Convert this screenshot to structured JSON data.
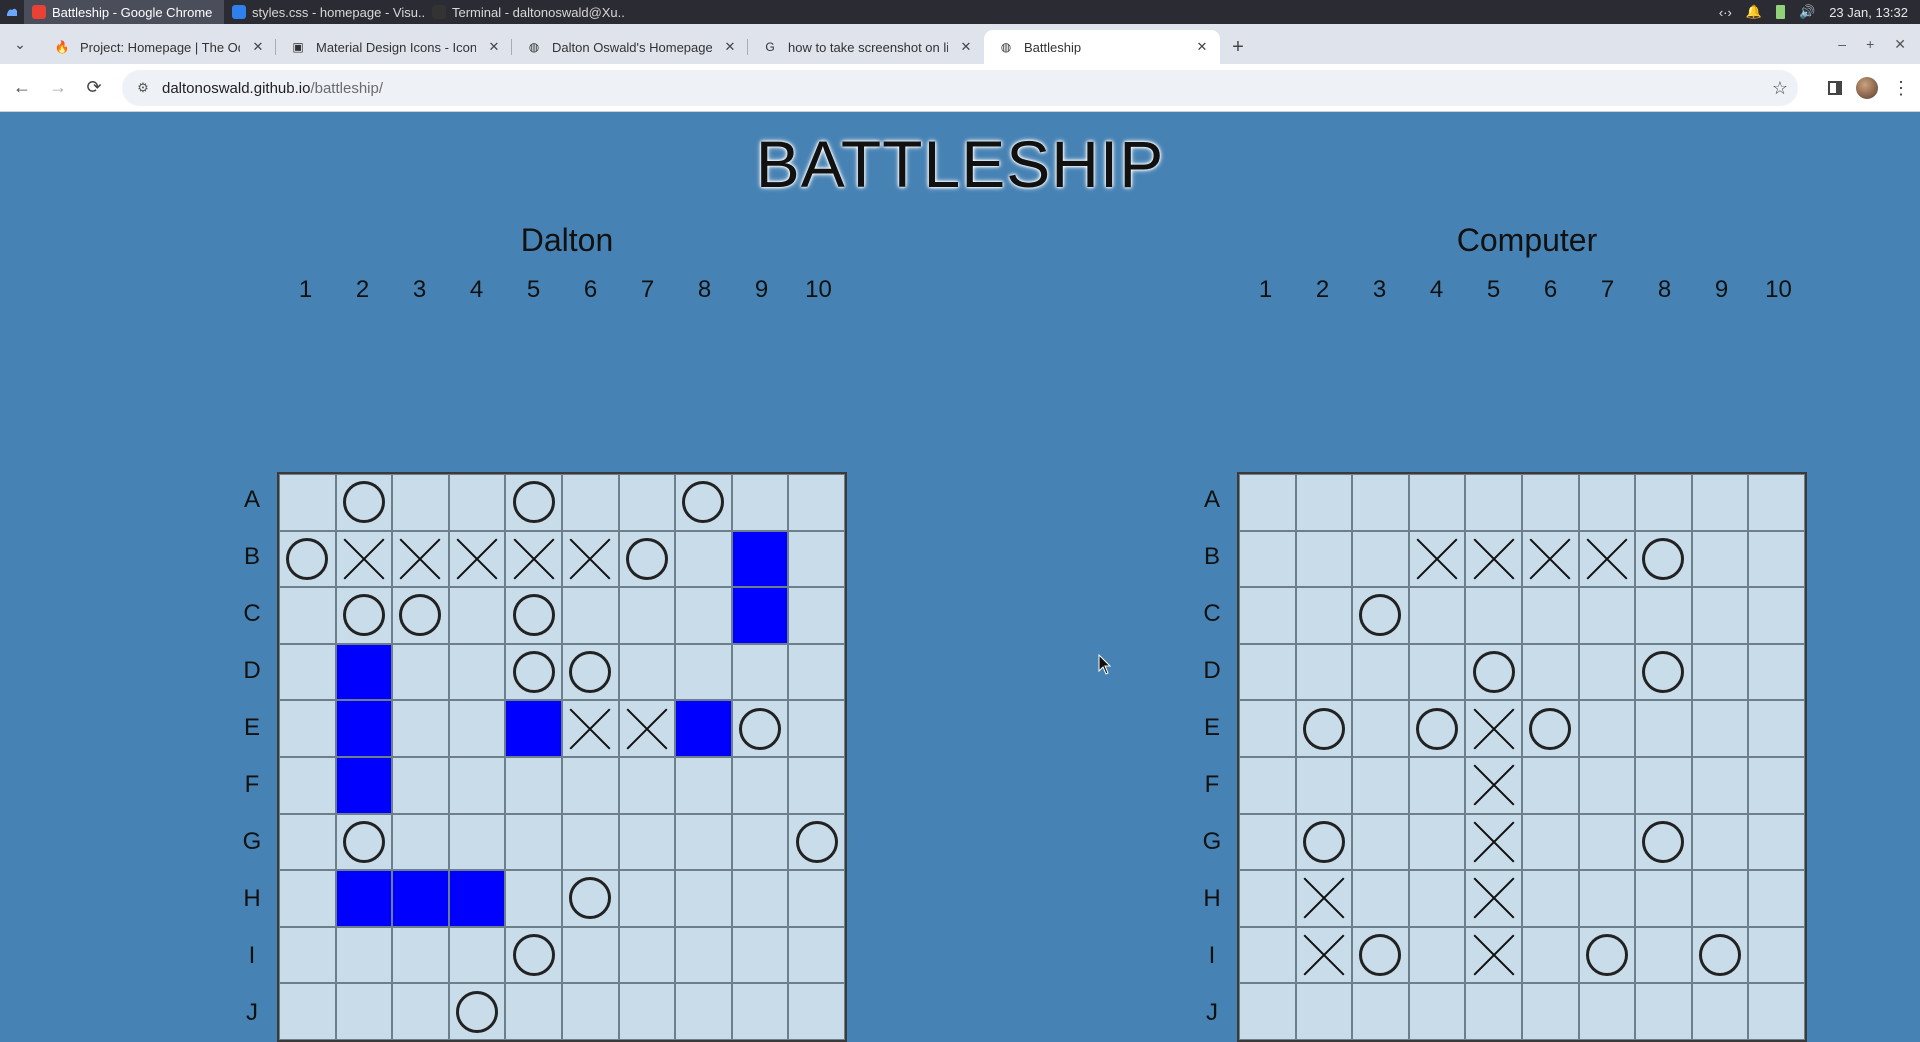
{
  "os": {
    "tasks": [
      {
        "label": "Battleship - Google Chrome",
        "icon": "chrome-icon",
        "active": true
      },
      {
        "label": "styles.css - homepage - Visu...",
        "icon": "vscode-icon",
        "active": false
      },
      {
        "label": "Terminal - daltonoswald@Xu...",
        "icon": "terminal-icon",
        "active": false
      }
    ],
    "clock": "23 Jan, 13:32"
  },
  "browser": {
    "tabs": [
      {
        "label": "Project: Homepage | The Odi"
      },
      {
        "label": "Material Design Icons - Icon L"
      },
      {
        "label": "Dalton Oswald's Homepage"
      },
      {
        "label": "how to take screenshot on lin"
      },
      {
        "label": "Battleship"
      }
    ],
    "url_host": "daltonoswald.github.io",
    "url_path": "/battleship/"
  },
  "game": {
    "title": "BATTLESHIP",
    "columns": [
      "1",
      "2",
      "3",
      "4",
      "5",
      "6",
      "7",
      "8",
      "9",
      "10"
    ],
    "rows": [
      "A",
      "B",
      "C",
      "D",
      "E",
      "F",
      "G",
      "H",
      "I",
      "J"
    ],
    "colors": {
      "ship": "#0000ff",
      "water": "#c9dcea",
      "background": "#4682b4"
    },
    "boards": [
      {
        "name": "Dalton",
        "grid": [
          ". O . . O . . O . .",
          "O X X X X X O . S .",
          ". O O . O . . . S .",
          ". S . . O O . . . .",
          ". S . . S X X S O .",
          ". S . . . . . . . .",
          ". O . . . . . . . O",
          ". S S S . O . . . .",
          ". . . . O . . . . .",
          ". . . O . . . . . ."
        ]
      },
      {
        "name": "Computer",
        "grid": [
          ". . . . . . . . . .",
          ". . . X X X X O . .",
          ". . O . . . . . . .",
          ". . . . O . . O . .",
          ". O . O X O . . . .",
          ". . . . X . . . . .",
          ". O . . X . . O . .",
          ". X . . X . . . . .",
          ". X O . X . O . O .",
          ". . . . . . . . . ."
        ]
      }
    ]
  }
}
